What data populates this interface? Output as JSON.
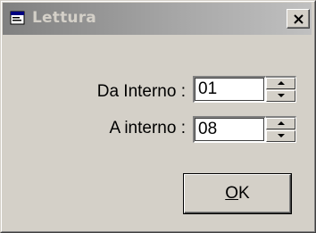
{
  "window": {
    "title": "Lettura",
    "close_label": "×"
  },
  "form": {
    "da_interno": {
      "label": "Da Interno :",
      "value": "01"
    },
    "a_interno": {
      "label": "A interno :",
      "value": "08"
    }
  },
  "buttons": {
    "ok_accel": "O",
    "ok_rest": "K"
  },
  "icons": {
    "title": "window-app-icon",
    "close": "close-icon",
    "up": "arrow-up-icon",
    "down": "arrow-down-icon"
  }
}
